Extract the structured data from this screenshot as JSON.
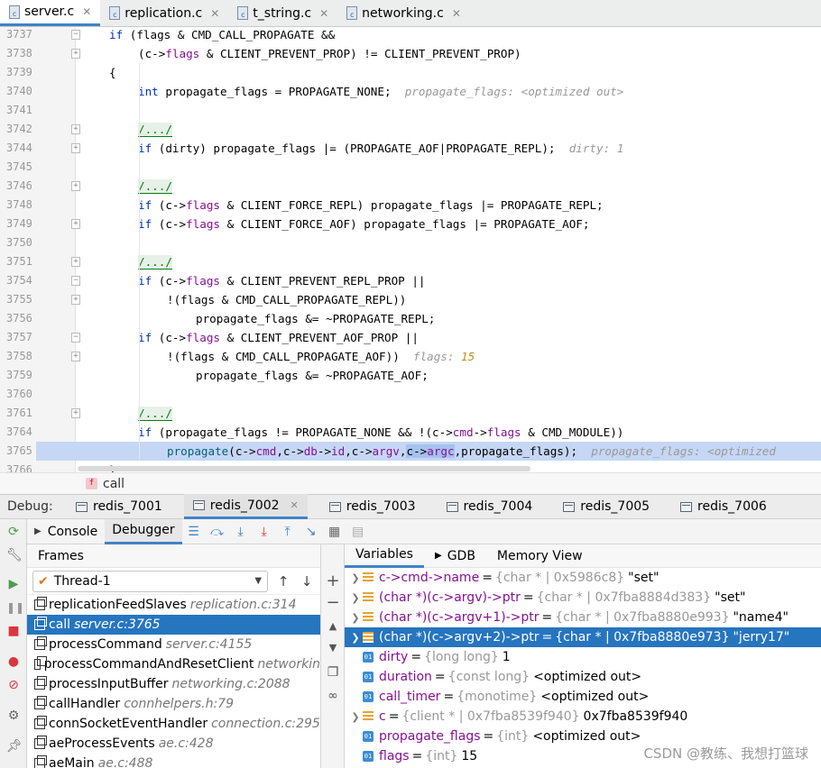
{
  "editor_tabs": [
    {
      "label": "server.c",
      "active": true
    },
    {
      "label": "replication.c",
      "active": false
    },
    {
      "label": "t_string.c",
      "active": false
    },
    {
      "label": "networking.c",
      "active": false
    }
  ],
  "code_lines": [
    {
      "n": "3737",
      "indent": 0,
      "html": "<span class='kw'>if</span> (flags &amp; CMD_CALL_PROPAGATE &amp;&amp;",
      "fold": "-"
    },
    {
      "n": "3738",
      "indent": 1,
      "html": "(c-&gt;<span class='fld'>flags</span> &amp; CLIENT_PREVENT_PROP) != CLIENT_PREVENT_PROP)",
      "fold": "+"
    },
    {
      "n": "3739",
      "indent": 0,
      "html": "{",
      "fold": ""
    },
    {
      "n": "3740",
      "indent": 1,
      "html": "<span class='kw'>int</span> propagate_flags = PROPAGATE_NONE;  <span class='hint'>propagate_flags: &lt;optimized out&gt;</span>",
      "fold": ""
    },
    {
      "n": "3741",
      "indent": 0,
      "html": "",
      "fold": ""
    },
    {
      "n": "3742",
      "indent": 1,
      "html": "<span class='fold-txt'>/.../</span>",
      "fold": "+"
    },
    {
      "n": "3744",
      "indent": 1,
      "html": "<span class='kw'>if</span> (dirty) propagate_flags |= (PROPAGATE_AOF|PROPAGATE_REPL);  <span class='hint'>dirty: 1</span>",
      "fold": "+"
    },
    {
      "n": "3745",
      "indent": 0,
      "html": "",
      "fold": ""
    },
    {
      "n": "3746",
      "indent": 1,
      "html": "<span class='fold-txt'>/.../</span>",
      "fold": "+"
    },
    {
      "n": "3748",
      "indent": 1,
      "html": "<span class='kw'>if</span> (c-&gt;<span class='fld'>flags</span> &amp; CLIENT_FORCE_REPL) propagate_flags |= PROPAGATE_REPL;",
      "fold": ""
    },
    {
      "n": "3749",
      "indent": 1,
      "html": "<span class='kw'>if</span> (c-&gt;<span class='fld'>flags</span> &amp; CLIENT_FORCE_AOF) propagate_flags |= PROPAGATE_AOF;",
      "fold": "+"
    },
    {
      "n": "3750",
      "indent": 0,
      "html": "",
      "fold": ""
    },
    {
      "n": "3751",
      "indent": 1,
      "html": "<span class='fold-txt'>/.../</span>",
      "fold": "+"
    },
    {
      "n": "3754",
      "indent": 1,
      "html": "<span class='kw'>if</span> (c-&gt;<span class='fld'>flags</span> &amp; CLIENT_PREVENT_REPL_PROP ||",
      "fold": "-"
    },
    {
      "n": "3755",
      "indent": 2,
      "html": "!(flags &amp; CMD_CALL_PROPAGATE_REPL))",
      "fold": "+"
    },
    {
      "n": "3756",
      "indent": 3,
      "html": "propagate_flags &amp;= ~PROPAGATE_REPL;",
      "fold": ""
    },
    {
      "n": "3757",
      "indent": 1,
      "html": "<span class='kw'>if</span> (c-&gt;<span class='fld'>flags</span> &amp; CLIENT_PREVENT_AOF_PROP ||",
      "fold": "-"
    },
    {
      "n": "3758",
      "indent": 2,
      "html": "!(flags &amp; CMD_CALL_PROPAGATE_AOF))  <span class='hint'>flags: <b style='color:#c38c1d'>15</b></span>",
      "fold": "+"
    },
    {
      "n": "3759",
      "indent": 3,
      "html": "propagate_flags &amp;= ~PROPAGATE_AOF;",
      "fold": ""
    },
    {
      "n": "3760",
      "indent": 0,
      "html": "",
      "fold": ""
    },
    {
      "n": "3761",
      "indent": 1,
      "html": "<span class='fold-txt'>/.../</span>",
      "fold": "+"
    },
    {
      "n": "3764",
      "indent": 1,
      "html": "<span class='kw'>if</span> (propagate_flags != PROPAGATE_NONE &amp;&amp; !(c-&gt;<span class='fld'>cmd</span>-&gt;<span class='fld'>flags</span> &amp; CMD_MODULE))",
      "fold": ""
    },
    {
      "n": "3765",
      "indent": 2,
      "html": "<span class='fn'>propagate</span>(c-&gt;<span class='fld'>cmd</span>,c-&gt;<span class='fld'>db</span>-&gt;<span class='fld'>id</span>,c-&gt;<span class='fld'>argv</span>,<span class='sel'>c-&gt;<span class='fld'>argc</span></span>,propagate_flags);  <span class='hint'>propagate_flags: &lt;optimized</span>",
      "fold": "",
      "hl": true
    },
    {
      "n": "3766",
      "indent": 0,
      "html": "}",
      "fold": ""
    }
  ],
  "breadcrumb": {
    "badge": "f",
    "label": "call"
  },
  "debug": {
    "title": "Debug:",
    "sessions": [
      {
        "label": "redis_7001",
        "active": false
      },
      {
        "label": "redis_7002",
        "active": true
      },
      {
        "label": "redis_7003",
        "active": false
      },
      {
        "label": "redis_7004",
        "active": false
      },
      {
        "label": "redis_7005",
        "active": false
      },
      {
        "label": "redis_7006",
        "active": false
      }
    ],
    "subtabs": {
      "console": "Console",
      "debugger": "Debugger"
    }
  },
  "frames": {
    "header": "Frames",
    "thread": "Thread-1",
    "items": [
      {
        "fn": "replicationFeedSlaves",
        "loc": "replication.c:314",
        "sel": false
      },
      {
        "fn": "call",
        "loc": "server.c:3765",
        "sel": true
      },
      {
        "fn": "processCommand",
        "loc": "server.c:4155",
        "sel": false
      },
      {
        "fn": "processCommandAndResetClient",
        "loc": "networkin",
        "sel": false
      },
      {
        "fn": "processInputBuffer",
        "loc": "networking.c:2088",
        "sel": false
      },
      {
        "fn": "callHandler",
        "loc": "connhelpers.h:79",
        "sel": false
      },
      {
        "fn": "connSocketEventHandler",
        "loc": "connection.c:295",
        "sel": false
      },
      {
        "fn": "aeProcessEvents",
        "loc": "ae.c:428",
        "sel": false
      },
      {
        "fn": "aeMain",
        "loc": "ae.c:488",
        "sel": false
      }
    ]
  },
  "variables": {
    "tabs": [
      "Variables",
      "GDB",
      "Memory View"
    ],
    "items": [
      {
        "expand": true,
        "icon": "struct",
        "name": "c->cmd->name",
        "type": "{char * | 0x5986c8}",
        "value": "\"set\"",
        "sel": false
      },
      {
        "expand": true,
        "icon": "struct",
        "name": "(char *)(c->argv)->ptr",
        "type": "{char * | 0x7fba8884d383}",
        "value": "\"set\"",
        "sel": false
      },
      {
        "expand": true,
        "icon": "struct",
        "name": "(char *)(c->argv+1)->ptr",
        "type": "{char * | 0x7fba8880e993}",
        "value": "\"name4\"",
        "sel": false
      },
      {
        "expand": true,
        "icon": "struct",
        "name": "(char *)(c->argv+2)->ptr",
        "type": "{char * | 0x7fba8880e973}",
        "value": "\"jerry17\"",
        "sel": true
      },
      {
        "expand": false,
        "icon": "prim",
        "name": "dirty",
        "type": "{long long}",
        "value": "1",
        "sel": false
      },
      {
        "expand": false,
        "icon": "prim",
        "name": "duration",
        "type": "{const long}",
        "value": "<optimized out>",
        "sel": false
      },
      {
        "expand": false,
        "icon": "prim",
        "name": "call_timer",
        "type": "{monotime}",
        "value": "<optimized out>",
        "sel": false
      },
      {
        "expand": true,
        "icon": "struct",
        "name": "c",
        "type": "{client * | 0x7fba8539f940}",
        "value": "0x7fba8539f940",
        "sel": false
      },
      {
        "expand": false,
        "icon": "prim",
        "name": "propagate_flags",
        "type": "{int}",
        "value": "<optimized out>",
        "sel": false
      },
      {
        "expand": false,
        "icon": "prim",
        "name": "flags",
        "type": "{int}",
        "value": "15",
        "sel": false
      }
    ]
  },
  "watermark": "CSDN @教练、我想打篮球",
  "colors": {
    "accent": "#4083c9",
    "selection": "#2675bf",
    "line_highlight": "#c5d7f5"
  }
}
